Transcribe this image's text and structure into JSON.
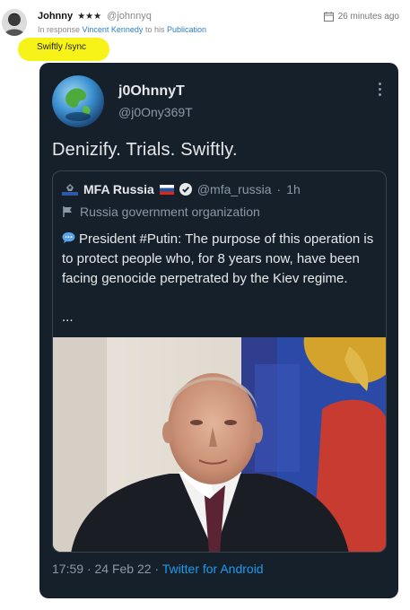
{
  "post": {
    "author_name": "Johnny",
    "author_stars": "★★★",
    "author_handle": "@johnnyq",
    "timestamp": "26 minutes ago",
    "response_prefix": "In response",
    "response_user": "Vincent Kennedy",
    "response_middle": "to his",
    "response_link": "Publication",
    "text": "Swiftly /sync"
  },
  "tweet": {
    "name": "j0OhnnyT",
    "handle": "@j0Ony369T",
    "text": "Denizify. Trials. Swiftly.",
    "time": "17:59",
    "date": "24 Feb 22",
    "separator": "·",
    "source": "Twitter for Android",
    "quote": {
      "name": "MFA Russia",
      "handle": "@mfa_russia",
      "time_sep": "·",
      "time": "1h",
      "label": "Russia government organization",
      "text": "President #Putin: The purpose of this operation is to protect people who, for 8 years now, have been facing genocide perpetrated by the Kiev regime.",
      "ellipsis": "..."
    }
  },
  "colors": {
    "highlight": "#f7f217",
    "tweet_bg": "#15202b",
    "link_blue": "#1d9bf0",
    "muted": "#8b98a5"
  },
  "icons": {
    "timestamp": "calendar-icon",
    "more": "more-vertical-icon",
    "verified": "verified-badge-icon",
    "label": "flag-icon",
    "speech": "speech-bubble-icon"
  }
}
